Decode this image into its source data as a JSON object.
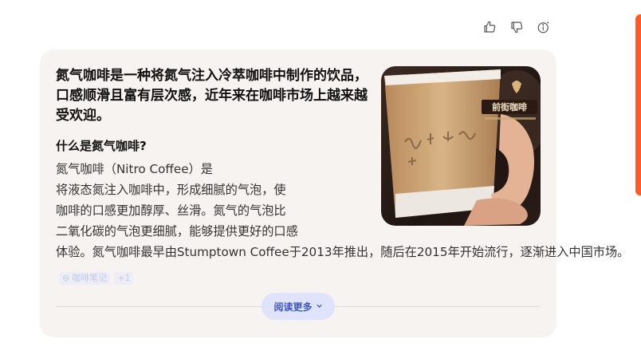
{
  "toolbar": {
    "icons": [
      "thumbs-up-icon",
      "thumbs-down-icon",
      "ai-info-icon"
    ]
  },
  "answer": {
    "headline": "氮气咖啡是一种将氮气注入冷萃咖啡中制作的饮品，口感顺滑且富有层次感，近年来在咖啡市场上越来越受欢迎。",
    "subheading": "什么是氮气咖啡?",
    "body": "氮气咖啡（Nitro Coffee）是将液态氮注入咖啡中，形成细腻的气泡，使咖啡的口感更加醇厚、丝滑。氮气的气泡比二氧化碳的气泡更细腻，能够提供更好的口感体验。氮气咖啡最早由Stumptown Coffee于2013年推出，随后在2015年开始流行，逐渐进入中国市场。",
    "source_label": "咖啡笔记",
    "source_count": "+1",
    "read_more": "阅读更多",
    "image_alt": "手持印有“前街咖啡”字样的牛皮纸咖啡杯"
  },
  "colors": {
    "card_bg": "#f6f3f0",
    "accent": "#3d57c8",
    "read_more_bg": "#dfe3fb",
    "side_panel_accent": "#ff5a2a"
  }
}
